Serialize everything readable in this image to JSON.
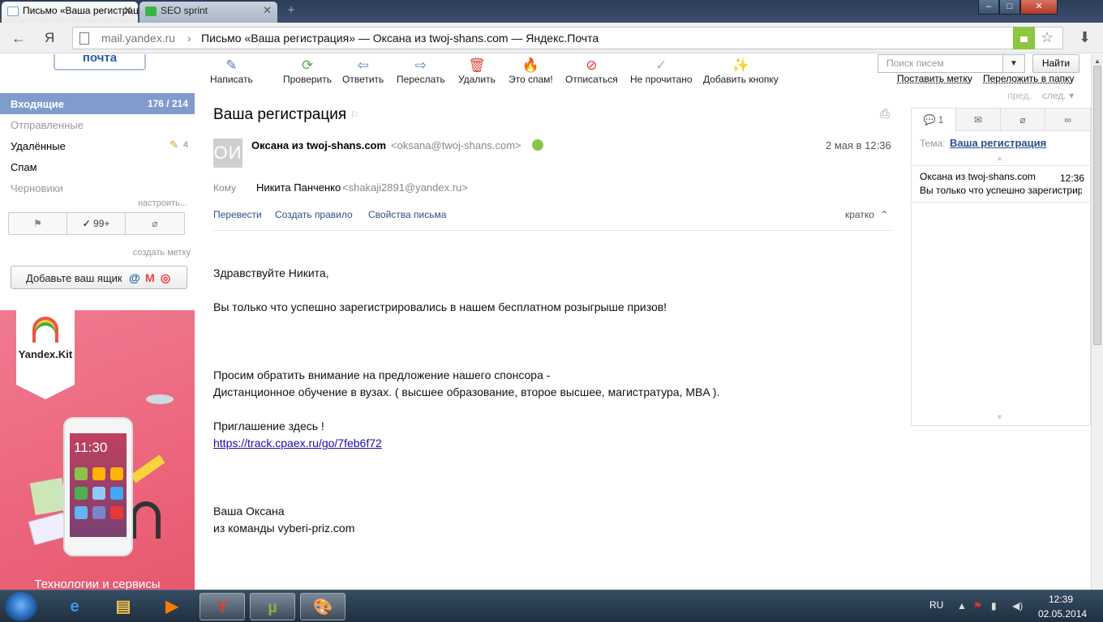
{
  "browser": {
    "tabs": [
      {
        "label": "Письмо «Ваша регистрация»",
        "active": true
      },
      {
        "label": "SEO sprint",
        "active": false
      }
    ],
    "new_tab_symbol": "+",
    "window_buttons": [
      "–",
      "□",
      "✕"
    ],
    "url_domain": "mail.yandex.ru",
    "url_separator": "›",
    "url_title": "Письмо «Ваша регистрация» — Оксана из twoj-shans.com — Яндекс.Почта",
    "back_glyph": "←",
    "yandex_glyph": "Я",
    "star_glyph": "☆",
    "download_glyph": "⬇"
  },
  "logo": {
    "text": "почта"
  },
  "folders": {
    "inbox": {
      "label": "Входящие",
      "count": "176 / 214"
    },
    "sent": {
      "label": "Отправленные"
    },
    "deleted": {
      "label": "Удалённые",
      "count": "4"
    },
    "spam": {
      "label": "Спам"
    },
    "drafts": {
      "label": "Черновики"
    },
    "setup_link": "настроить..."
  },
  "filters": {
    "flag": "⚑",
    "read_count": "99+",
    "attach": "📎"
  },
  "create_label": "создать метку",
  "add_mailbox": {
    "label": "Добавьте ваш ящик"
  },
  "ad": {
    "brand": "Yandex.Kit",
    "phone_time": "11:30",
    "text": "Технологии и сервисы"
  },
  "actions": [
    {
      "label": "Написать",
      "icon": "compose-icon",
      "glyph": "✎",
      "color": "#5b7fb5"
    },
    {
      "label": "Проверить",
      "icon": "refresh-icon",
      "glyph": "⟳",
      "color": "#4caf50"
    },
    {
      "label": "Ответить",
      "icon": "reply-icon",
      "glyph": "⇦",
      "color": "#5b7fb5"
    },
    {
      "label": "Переслать",
      "icon": "forward-icon",
      "glyph": "⇨",
      "color": "#5b7fb5"
    },
    {
      "label": "Удалить",
      "icon": "trash-icon",
      "glyph": "🗑",
      "color": "#d94a3a"
    },
    {
      "label": "Это спам!",
      "icon": "fire-icon",
      "glyph": "🔥",
      "color": "#f5a623"
    },
    {
      "label": "Отписаться",
      "icon": "unsubscribe-icon",
      "glyph": "⊘",
      "color": "#e53935"
    },
    {
      "label": "Не прочитано",
      "icon": "check-icon",
      "glyph": "✓",
      "color": "#9db4d6"
    },
    {
      "label": "Добавить кнопку",
      "icon": "magic-wand-icon",
      "glyph": "✨",
      "color": "#e05050"
    }
  ],
  "search": {
    "placeholder": "Поиск писем",
    "button": "Найти",
    "dropdown": "▼"
  },
  "links": {
    "label": "Поставить метку",
    "move": "Переложить в папку"
  },
  "pager": {
    "prev": "пред.",
    "next": "след. ▾"
  },
  "message": {
    "subject": "Ваша регистрация",
    "avatar": "ОИ",
    "from_name": "Оксана из twoj-shans.com",
    "from_addr": "<oksana@twoj-shans.com>",
    "date": "2 мая в 12:36",
    "to_label": "Кому",
    "to_name": "Никита Панченко",
    "to_addr": "<shakaji2891@yandex.ru>",
    "translate": "Перевести",
    "create_rule": "Создать правило",
    "properties": "Свойства письма",
    "brief": "кратко",
    "body": {
      "greeting": "Здравствуйте Никита,",
      "line1": "Вы только что успешно зарегистрировались в нашем бесплатном розыгрыше призов!",
      "line2": "Просим обратить внимание на предложение нашего спонсора -",
      "line3": "Дистанционное обучение в вузах. ( высшее образование, второе высшее, магистратура, MBA ).",
      "line4": "Приглашение здесь !",
      "link": "https://track.cpaex.ru/go/7feb6f72",
      "sign1": "Ваша Оксана",
      "sign2": "из команды vyberi-priz.com"
    }
  },
  "thread": {
    "count": "1",
    "theme_label": "Тема:",
    "theme": "Ваша регистрация",
    "item": {
      "sender": "Оксана из twoj-shans.com",
      "time": "12:36",
      "snippet": "Вы только что успешно зарегистрировались"
    }
  },
  "taskbar": {
    "lang": "RU",
    "time": "12:39",
    "date": "02.05.2014"
  }
}
